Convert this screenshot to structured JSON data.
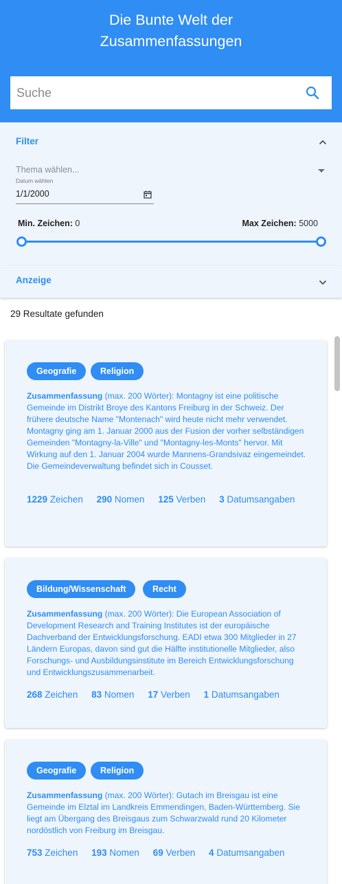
{
  "header": {
    "title_line1": "Die Bunte Welt der",
    "title_line2": "Zusammenfassungen",
    "background_color": "#2f8df3"
  },
  "search": {
    "placeholder": "Suche",
    "value": "",
    "icon": "search-icon"
  },
  "filter": {
    "title": "Filter",
    "expanded": true,
    "topic_placeholder": "Thema wählen...",
    "date_label": "Datum wählen",
    "date_value": "1/1/2000",
    "min_label": "Min. Zeichen:",
    "min_value": "0",
    "max_label": "Max Zeichen:",
    "max_value": "5000"
  },
  "anzeige": {
    "title": "Anzeige",
    "expanded": false
  },
  "results": {
    "count_text": "29 Resultate gefunden",
    "items": [
      {
        "tags": [
          "Geografie",
          "Religion"
        ],
        "summary_label": "Zusammenfassung",
        "summary_text": " (max. 200 Wörter): Montagny ist eine politische Gemeinde im Distrikt Broye des Kantons Freiburg in der Schweiz. Der frühere deutsche Name \"Montenach\" wird heute nicht mehr verwendet. Montagny ging am 1. Januar 2000 aus der Fusion der vorher selbständigen Gemeinden \"Montagny-la-Ville\" und \"Montagny-les-Monts\" hervor. Mit Wirkung auf den 1. Januar 2004 wurde Mannens-Grandsivaz eingemeindet. Die Gemeindeverwaltung befindet sich in Cousset.",
        "zeichen": "1229",
        "zeichen_label": "Zeichen",
        "nomen": "290",
        "nomen_label": "Nomen",
        "verben": "125",
        "verben_label": "Verben",
        "datum": "3",
        "datum_label": "Datumsangaben"
      },
      {
        "tags": [
          "Bildung/Wissenschaft",
          "Recht"
        ],
        "summary_label": "Zusammenfassung",
        "summary_text": " (max. 200 Wörter): Die European Association of Development Research and Training Institutes ist der europäische Dachverband der Entwicklungsforschung. EADI etwa 300 Mitglieder in 27 Ländern Europas, davon sind gut die Hälfte institutionelle Mitglieder, also Forschungs- und Ausbildungsinstitute im Bereich Entwicklungsforschung und Entwicklungszusammenarbeit.",
        "zeichen": "268",
        "zeichen_label": "Zeichen",
        "nomen": "83",
        "nomen_label": "Nomen",
        "verben": "17",
        "verben_label": "Verben",
        "datum": "1",
        "datum_label": "Datumsangaben"
      },
      {
        "tags": [
          "Geografie",
          "Religion"
        ],
        "summary_label": "Zusammenfassung",
        "summary_text": " (max. 200 Wörter): Gutach im Breisgau ist eine Gemeinde im Elztal im Landkreis Emmendingen, Baden-Württemberg. Sie liegt am Übergang des Breisgaus zum Schwarzwald rund 20 Kilometer nordöstlich von Freiburg im Breisgau.",
        "zeichen": "753",
        "zeichen_label": "Zeichen",
        "nomen": "193",
        "nomen_label": "Nomen",
        "verben": "69",
        "verben_label": "Verben",
        "datum": "4",
        "datum_label": "Datumsangaben"
      }
    ]
  },
  "colors": {
    "accent": "#2f8df3",
    "panel_background": "#eef5fd"
  }
}
